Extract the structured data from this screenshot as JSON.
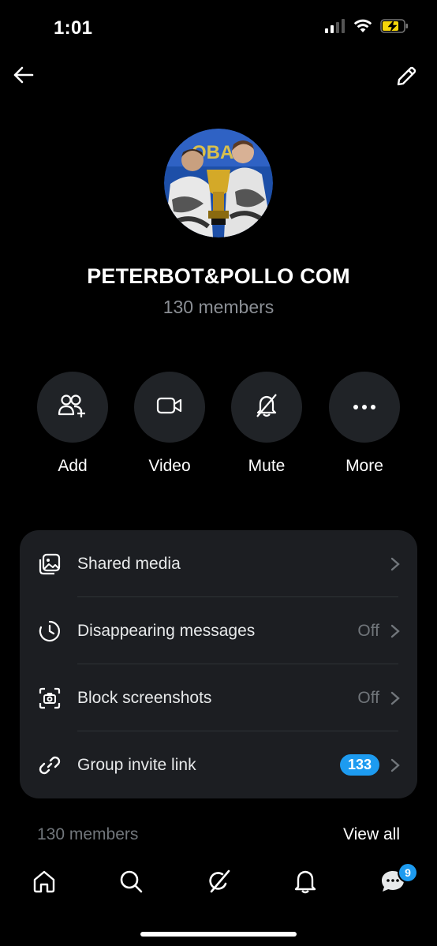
{
  "status_bar": {
    "time": "1:01"
  },
  "header": {
    "back_icon": "arrow-left-icon",
    "edit_icon": "pencil-icon"
  },
  "group": {
    "name": "PETERBOT&POLLO COM",
    "member_count": "130 members"
  },
  "actions": [
    {
      "label": "Add",
      "icon": "add-people-icon"
    },
    {
      "label": "Video",
      "icon": "video-camera-icon"
    },
    {
      "label": "Mute",
      "icon": "bell-off-icon"
    },
    {
      "label": "More",
      "icon": "more-horizontal-icon"
    }
  ],
  "settings": [
    {
      "label": "Shared media",
      "value": "",
      "icon": "media-gallery-icon"
    },
    {
      "label": "Disappearing messages",
      "value": "Off",
      "icon": "timer-icon"
    },
    {
      "label": "Block screenshots",
      "value": "Off",
      "icon": "camera-block-icon"
    },
    {
      "label": "Group invite link",
      "value": "133",
      "icon": "link-icon"
    }
  ],
  "members_section": {
    "label": "130 members",
    "view_all": "View all"
  },
  "navbar": {
    "items": [
      "home-icon",
      "search-icon",
      "grok-icon",
      "notifications-icon",
      "messages-icon"
    ],
    "messages_badge": "9"
  },
  "colors": {
    "accent": "#1d9bf0",
    "card_bg": "#1c1e22",
    "circle_bg": "#202327",
    "muted": "#71767b"
  }
}
